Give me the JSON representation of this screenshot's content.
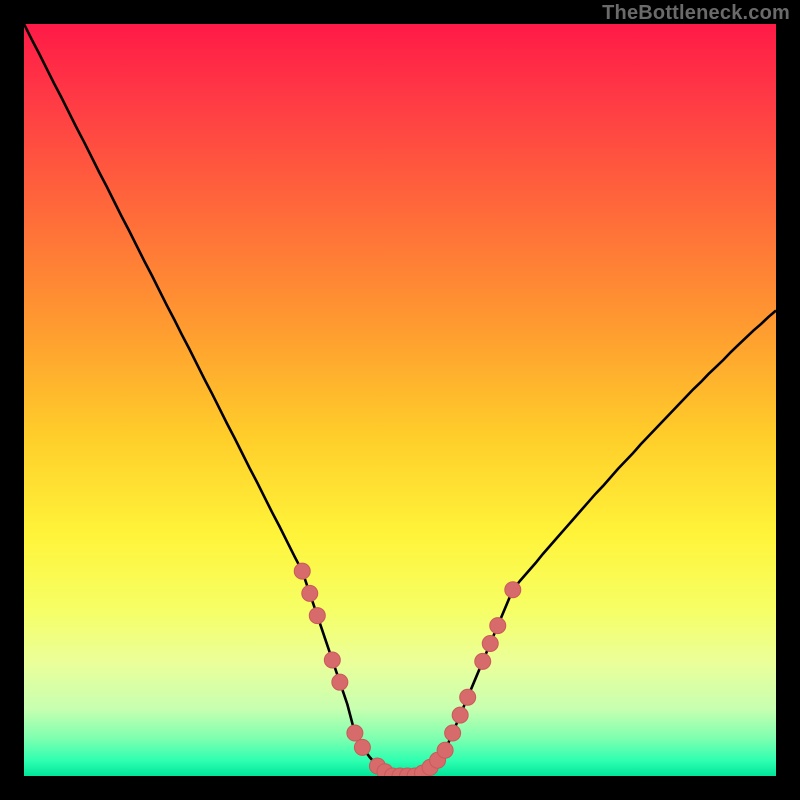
{
  "attribution": "TheBottleneck.com",
  "colors": {
    "frame": "#000000",
    "curve_stroke": "#000000",
    "marker_fill": "#d76a6a",
    "marker_stroke": "#c95a5a",
    "gradient_stops": [
      "#ff1a47",
      "#ff3a45",
      "#ff6a3a",
      "#ff9a30",
      "#ffce2a",
      "#fff43a",
      "#f6ff66",
      "#eaff9a",
      "#c8ffb0",
      "#7effb0",
      "#2dffb0",
      "#00e59a"
    ]
  },
  "chart_data": {
    "type": "line",
    "title": "",
    "xlabel": "",
    "ylabel": "",
    "xlim": [
      0,
      100
    ],
    "ylim": [
      0,
      105
    ],
    "x": [
      0,
      1,
      2,
      3,
      4,
      5,
      6,
      7,
      8,
      9,
      10,
      11,
      12,
      13,
      14,
      15,
      16,
      17,
      18,
      19,
      20,
      21,
      22,
      23,
      24,
      25,
      26,
      27,
      28,
      29,
      30,
      31,
      32,
      33,
      34,
      35,
      36,
      37,
      38,
      39,
      40,
      41,
      42,
      43,
      44,
      45,
      46,
      47,
      48,
      49,
      50,
      51,
      52,
      53,
      54,
      55,
      56,
      57,
      58,
      59,
      60,
      61,
      62,
      63,
      64,
      65,
      66,
      67,
      68,
      69,
      70,
      71,
      72,
      73,
      74,
      75,
      76,
      77,
      78,
      79,
      80,
      81,
      82,
      83,
      84,
      85,
      86,
      87,
      88,
      89,
      90,
      91,
      92,
      93,
      94,
      95,
      96,
      97,
      98,
      99,
      100
    ],
    "y": [
      105.0,
      102.9,
      100.9,
      98.8,
      96.7,
      94.7,
      92.6,
      90.5,
      88.5,
      86.4,
      84.3,
      82.3,
      80.2,
      78.1,
      76.1,
      74.0,
      71.9,
      69.9,
      67.8,
      65.7,
      63.7,
      61.6,
      59.6,
      57.5,
      55.4,
      53.4,
      51.3,
      49.2,
      47.2,
      45.1,
      43.0,
      41.0,
      38.9,
      36.8,
      34.8,
      32.7,
      30.6,
      28.6,
      25.5,
      22.4,
      19.3,
      16.2,
      13.1,
      10.0,
      6.0,
      4.0,
      2.6,
      1.4,
      0.6,
      0.0,
      0.0,
      0.0,
      0.0,
      0.4,
      1.2,
      2.2,
      3.6,
      6.0,
      8.5,
      11.0,
      13.5,
      16.0,
      18.5,
      21.0,
      23.5,
      26.0,
      27.3,
      28.5,
      29.7,
      31.0,
      32.2,
      33.4,
      34.6,
      35.8,
      37.0,
      38.2,
      39.4,
      40.5,
      41.7,
      42.9,
      44.0,
      45.1,
      46.3,
      47.4,
      48.5,
      49.6,
      50.7,
      51.8,
      52.9,
      54.0,
      55.0,
      56.1,
      57.1,
      58.1,
      59.2,
      60.2,
      61.2,
      62.2,
      63.1,
      64.1,
      65.0
    ],
    "markers": [
      {
        "x": 37,
        "y": 28.6
      },
      {
        "x": 38,
        "y": 25.5
      },
      {
        "x": 39,
        "y": 22.4
      },
      {
        "x": 41,
        "y": 16.2
      },
      {
        "x": 42,
        "y": 13.1
      },
      {
        "x": 44,
        "y": 6.0
      },
      {
        "x": 45,
        "y": 4.0
      },
      {
        "x": 47,
        "y": 1.4
      },
      {
        "x": 48,
        "y": 0.6
      },
      {
        "x": 49,
        "y": 0.0
      },
      {
        "x": 50,
        "y": 0.0
      },
      {
        "x": 51,
        "y": 0.0
      },
      {
        "x": 52,
        "y": 0.0
      },
      {
        "x": 53,
        "y": 0.4
      },
      {
        "x": 54,
        "y": 1.2
      },
      {
        "x": 55,
        "y": 2.2
      },
      {
        "x": 56,
        "y": 3.6
      },
      {
        "x": 57,
        "y": 6.0
      },
      {
        "x": 58,
        "y": 8.5
      },
      {
        "x": 59,
        "y": 11.0
      },
      {
        "x": 61,
        "y": 16.0
      },
      {
        "x": 62,
        "y": 18.5
      },
      {
        "x": 63,
        "y": 21.0
      },
      {
        "x": 65,
        "y": 26.0
      }
    ]
  }
}
